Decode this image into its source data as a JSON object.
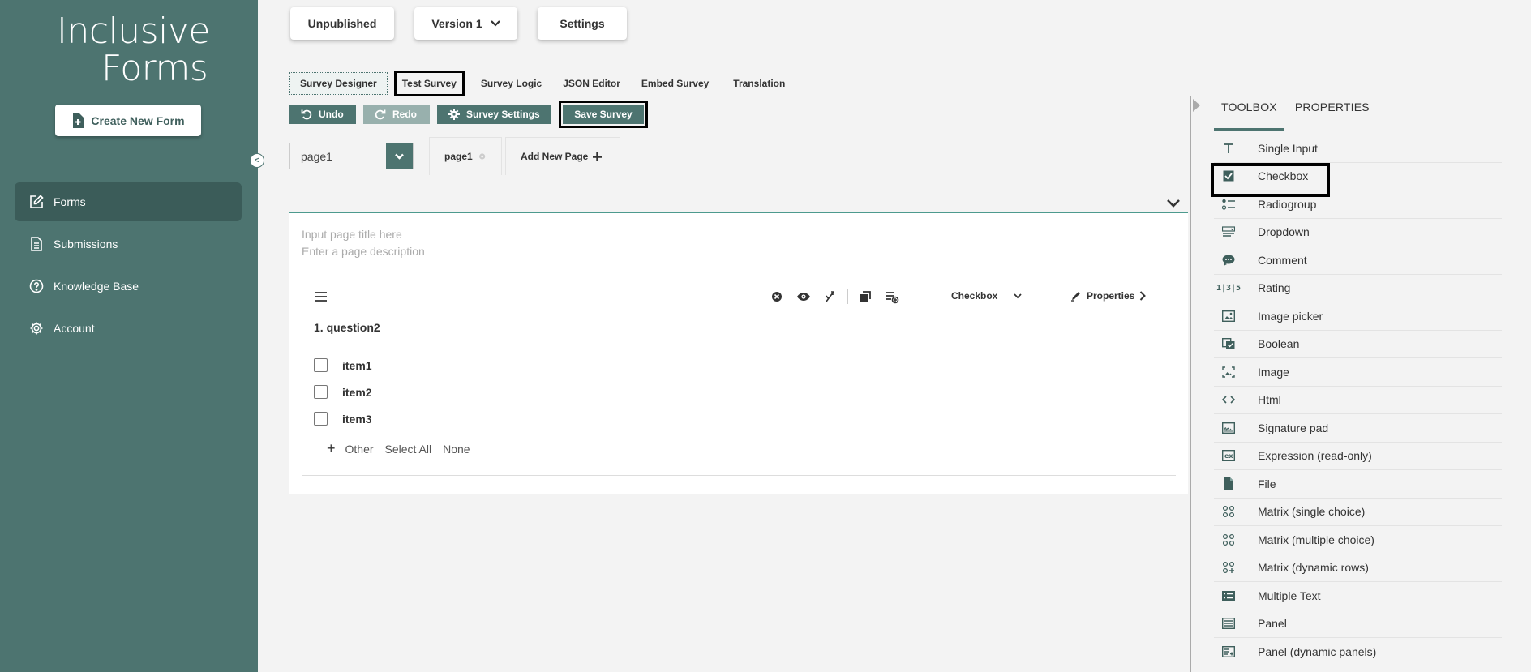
{
  "sidebar": {
    "logo_line1": "Inclusive",
    "logo_line2": "Forms",
    "create_label": "Create New Form",
    "collapse_label": "<",
    "items": [
      {
        "label": "Forms"
      },
      {
        "label": "Submissions"
      },
      {
        "label": "Knowledge Base"
      },
      {
        "label": "Account"
      }
    ]
  },
  "header": {
    "status_label": "Unpublished",
    "version_label": "Version 1",
    "settings_label": "Settings"
  },
  "tabs": [
    "Survey Designer",
    "Test Survey",
    "Survey Logic",
    "JSON Editor",
    "Embed Survey",
    "Translation"
  ],
  "toolbar": {
    "undo": "Undo",
    "redo": "Redo",
    "survey_settings": "Survey Settings",
    "save": "Save Survey"
  },
  "pages": {
    "selected": "page1",
    "tab": "page1",
    "add": "Add New Page"
  },
  "canvas": {
    "title_placeholder": "Input page title here",
    "desc_placeholder": "Enter a page description",
    "question": {
      "type": "Checkbox",
      "properties": "Properties",
      "title": "1. question2",
      "items": [
        "item1",
        "item2",
        "item3"
      ],
      "actions": [
        "Other",
        "Select All",
        "None"
      ]
    }
  },
  "panel": {
    "tabs": [
      "TOOLBOX",
      "PROPERTIES"
    ],
    "tools": [
      {
        "label": "Single Input",
        "icon": "text-icon"
      },
      {
        "label": "Checkbox",
        "icon": "checkbox-icon"
      },
      {
        "label": "Radiogroup",
        "icon": "radiogroup-icon"
      },
      {
        "label": "Dropdown",
        "icon": "dropdown-icon"
      },
      {
        "label": "Comment",
        "icon": "comment-icon"
      },
      {
        "label": "Rating",
        "icon": "rating-icon"
      },
      {
        "label": "Image picker",
        "icon": "image-picker-icon"
      },
      {
        "label": "Boolean",
        "icon": "boolean-icon"
      },
      {
        "label": "Image",
        "icon": "image-icon"
      },
      {
        "label": "Html",
        "icon": "code-icon"
      },
      {
        "label": "Signature pad",
        "icon": "signature-icon"
      },
      {
        "label": "Expression (read-only)",
        "icon": "expression-icon"
      },
      {
        "label": "File",
        "icon": "file-icon"
      },
      {
        "label": "Matrix (single choice)",
        "icon": "matrix-icon"
      },
      {
        "label": "Matrix (multiple choice)",
        "icon": "matrix-icon"
      },
      {
        "label": "Matrix (dynamic rows)",
        "icon": "matrix-dynamic-icon"
      },
      {
        "label": "Multiple Text",
        "icon": "multiple-text-icon"
      },
      {
        "label": "Panel",
        "icon": "panel-icon"
      },
      {
        "label": "Panel (dynamic panels)",
        "icon": "panel-dynamic-icon"
      }
    ]
  }
}
